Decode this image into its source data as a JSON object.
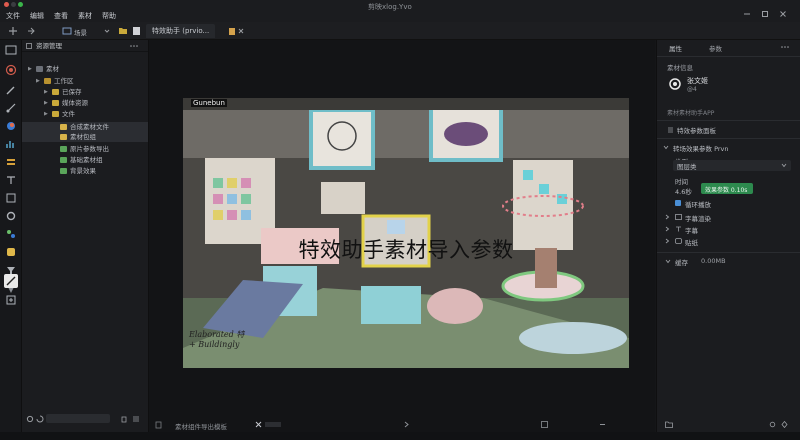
{
  "window": {
    "title": "剪映xlog.Yvo",
    "menu": [
      "文件",
      "编辑",
      "查看",
      "素材",
      "帮助"
    ]
  },
  "toolbar": {
    "scene_label": "场景",
    "tabs": [
      {
        "label": "特效助手 (prvio..."
      },
      {
        "label": "特效助手(prvio..."
      }
    ]
  },
  "outline": {
    "title": "资源管理",
    "items": [
      {
        "label": "素材",
        "depth": 0,
        "icon_color": "#6b6f77"
      },
      {
        "label": "工作区",
        "depth": 1,
        "icon_color": "#b8912f"
      },
      {
        "label": "已保存",
        "depth": 2,
        "icon_color": "#c9a93a"
      },
      {
        "label": "媒体资源",
        "depth": 2,
        "icon_color": "#c9a93a"
      },
      {
        "label": "文件",
        "depth": 2,
        "icon_color": "#c9a93a"
      },
      {
        "label": "合成素材文件",
        "depth": 3,
        "icon_color": "#d7b34a",
        "selected": true
      },
      {
        "label": "素材包组",
        "depth": 3,
        "icon_color": "#d7b34a",
        "selected": true
      },
      {
        "label": "原片参数导出",
        "depth": 3,
        "icon_color": "#5aa55a"
      },
      {
        "label": "基础素材组",
        "depth": 3,
        "icon_color": "#5aa55a"
      },
      {
        "label": "背景效果",
        "depth": 3,
        "icon_color": "#5aa55a"
      }
    ],
    "search_placeholder": ""
  },
  "stage": {
    "video_overlay_text": "特效助手素材导入参数",
    "video_corner_label": "Gunebun",
    "watermark_text": "Elaborated 特+ Buildingly",
    "bottom_item": "素材组件导出模板"
  },
  "inspector": {
    "tab_label": "属性",
    "tab_label_2": "参数",
    "section_label": "素材信息",
    "username": "张文姬",
    "user_sub": "@4",
    "hint": "素材素材助手APP",
    "sub_header": "特效参数面板",
    "panel_title": "转场效果参数 Prvn",
    "field_label": "类型",
    "dropdown_value": "图层类",
    "duration_label": "时间",
    "duration_value": "4.6秒",
    "badge_text": "效果参数 0.10s",
    "checkbox_label": "循环播放",
    "list": [
      {
        "label": "字幕渲染"
      },
      {
        "label": "字幕"
      },
      {
        "label": "贴纸"
      }
    ],
    "footer_label": "缓存",
    "footer_value": "0.00MB",
    "accent": "#2d8a4e"
  }
}
